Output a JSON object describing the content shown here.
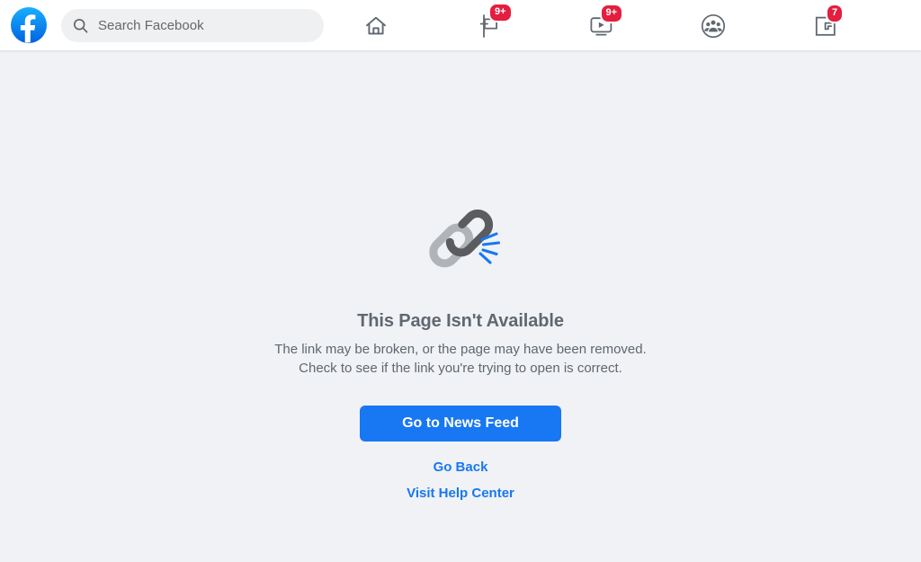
{
  "header": {
    "logo_icon": "facebook-logo-icon",
    "search": {
      "icon": "search-icon",
      "placeholder": "Search Facebook",
      "value": ""
    },
    "nav_items": [
      {
        "name": "home",
        "icon": "home-icon",
        "label": "Home",
        "badge": ""
      },
      {
        "name": "pages",
        "icon": "flag-icon",
        "label": "Pages",
        "badge": "9+"
      },
      {
        "name": "watch",
        "icon": "watch-icon",
        "label": "Watch",
        "badge": "9+"
      },
      {
        "name": "groups",
        "icon": "groups-icon",
        "label": "Groups",
        "badge": ""
      },
      {
        "name": "gaming",
        "icon": "gaming-icon",
        "label": "Gaming",
        "badge": "7"
      }
    ]
  },
  "main": {
    "illustration": "broken-link-icon",
    "title": "This Page Isn't Available",
    "description": "The link may be broken, or the page may have been removed. Check to see if the link you're trying to open is correct.",
    "primary_button": "Go to News Feed",
    "links": [
      "Go Back",
      "Visit Help Center"
    ]
  },
  "colors": {
    "brand_blue": "#1877F2",
    "badge_red": "#E41E3F",
    "page_bg": "#F0F2F5",
    "header_bg": "#FFFFFF",
    "text_gray": "#606770",
    "link_dark_gray": "#65676B"
  }
}
